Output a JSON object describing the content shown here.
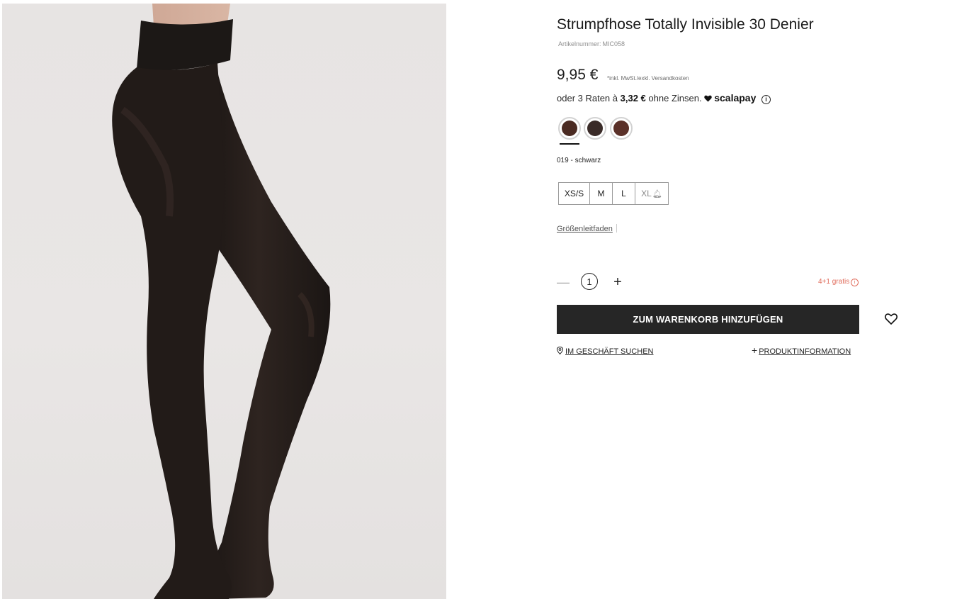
{
  "product": {
    "title": "Strumpfhose Totally Invisible 30 Denier",
    "sku_label": "Artikelnummer:",
    "sku": "MIC058",
    "price": "9,95 €",
    "tax_note": "*inkl. MwSt./exkl. Versandkosten"
  },
  "installments": {
    "prefix": "oder 3 Raten à",
    "amount": "3,32 €",
    "suffix": "ohne Zinsen.",
    "provider": "scalapay"
  },
  "colors": {
    "selected_name": "019 - schwarz",
    "swatches": [
      {
        "name": "color-swatch-1",
        "color": "#4a2a22",
        "selected": true
      },
      {
        "name": "color-swatch-2",
        "color": "#3a2b28",
        "selected": false
      },
      {
        "name": "color-swatch-3",
        "color": "#5a3028",
        "selected": false
      }
    ]
  },
  "sizes": [
    "XS/S",
    "M",
    "L",
    "XL"
  ],
  "size_guide": "Größenleitfaden",
  "quantity": {
    "value": "1",
    "minus": "—",
    "plus": "+"
  },
  "promo": "4+1 gratis",
  "cart_button": "ZUM WARENKORB HINZUFÜGEN",
  "store_link": "IM GESCHÄFT SUCHEN",
  "product_info_link": "PRODUKTINFORMATION",
  "icons": {
    "wishlist": "heart-outline-icon",
    "store": "map-pin-icon",
    "info": "info-circle-icon",
    "notify": "bell-icon"
  }
}
